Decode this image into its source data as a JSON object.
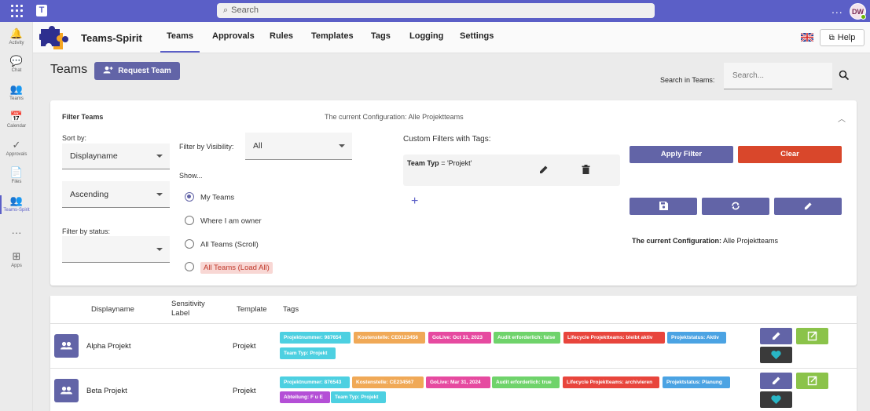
{
  "topbar": {
    "search_placeholder": "Search",
    "avatar_initials": "DW",
    "more": "..."
  },
  "rail": [
    {
      "label": "Activity",
      "icon": "bell-icon",
      "glyph": "🔔"
    },
    {
      "label": "Chat",
      "icon": "chat-icon",
      "glyph": "💬"
    },
    {
      "label": "Teams",
      "icon": "teams-icon",
      "glyph": "👥"
    },
    {
      "label": "Calendar",
      "icon": "calendar-icon",
      "glyph": "📅"
    },
    {
      "label": "Approvals",
      "icon": "approvals-icon",
      "glyph": "✓"
    },
    {
      "label": "Files",
      "icon": "file-icon",
      "glyph": "📄"
    },
    {
      "label": "Teams-Spirit",
      "icon": "teams-spirit-icon",
      "glyph": "👥"
    },
    {
      "label": "",
      "icon": "more-icon",
      "glyph": "···"
    },
    {
      "label": "Apps",
      "icon": "apps-icon",
      "glyph": "⊞"
    }
  ],
  "app": {
    "name": "Teams-Spirit",
    "tabs": [
      "Teams",
      "Approvals",
      "Rules",
      "Templates",
      "Tags",
      "Logging",
      "Settings"
    ],
    "active_tab": "Teams",
    "help_label": "Help"
  },
  "page": {
    "title": "Teams",
    "request_button": "Request Team",
    "search_label": "Search in Teams:",
    "search_placeholder": "Search..."
  },
  "filter": {
    "title": "Filter Teams",
    "current_config_header": "The current Configuration: Alle Projektteams",
    "sort_by_label": "Sort by:",
    "sort_by_value": "Displayname",
    "order_value": "Ascending",
    "status_label": "Filter by status:",
    "status_value": "",
    "visibility_label": "Filter by Visibility:",
    "visibility_value": "All",
    "show_label": "Show...",
    "show_options": [
      "My Teams",
      "Where I am owner",
      "All Teams (Scroll)",
      "All Teams (Load All)"
    ],
    "show_selected": "My Teams",
    "custom_tags_label": "Custom Filters with Tags:",
    "tag_filter_key": "Team Typ",
    "tag_filter_rest": " = 'Projekt'",
    "add_symbol": "+",
    "apply_button": "Apply Filter",
    "clear_button": "Clear",
    "current_config_label": "The current Configuration:",
    "current_config_value": " Alle Projektteams"
  },
  "table": {
    "headers": {
      "displayname": "Displayname",
      "sensitivity": "Sensitivity Label",
      "template": "Template",
      "tags": "Tags"
    },
    "rows": [
      {
        "name": "Alpha Projekt",
        "template": "Projekt",
        "tags": [
          {
            "text": "Projektnummer: 987654",
            "color": "#4dd0e1"
          },
          {
            "text": "Kostenstelle: CE0123456",
            "color": "#f0a957"
          },
          {
            "text": "GoLive: Oct 31, 2023",
            "color": "#e64aa0"
          },
          {
            "text": "Audit erforderlich: false",
            "color": "#6fd36b"
          },
          {
            "text": "Lifecycle Projektteams: bleibt aktiv",
            "color": "#e8453c"
          },
          {
            "text": "Projektstatus: Aktiv",
            "color": "#4ba3e3"
          },
          {
            "text": "Team Typ: Projekt",
            "color": "#4dd0e1"
          }
        ]
      },
      {
        "name": "Beta Projekt",
        "template": "Projekt",
        "tags": [
          {
            "text": "Projektnummer: 876543",
            "color": "#4dd0e1"
          },
          {
            "text": "Kostenstelle: CE234567",
            "color": "#f0a957"
          },
          {
            "text": "GoLive: Mar 31, 2024",
            "color": "#e64aa0"
          },
          {
            "text": "Audit erforderlich: true",
            "color": "#6fd36b"
          },
          {
            "text": "Lifecycle Projektteams: archivieren",
            "color": "#e8453c"
          },
          {
            "text": "Projektstatus: Planung",
            "color": "#4ba3e3"
          },
          {
            "text": "Abteilung: F u E",
            "color": "#b44fd6"
          },
          {
            "text": "Team Typ: Projekt",
            "color": "#4dd0e1"
          }
        ]
      }
    ]
  },
  "colors": {
    "brand": "#5b5fc7",
    "primary_button": "#6264a7",
    "clear_button": "#d9472b",
    "open_button": "#8bc34a",
    "dark_button": "#3a3a3a"
  }
}
